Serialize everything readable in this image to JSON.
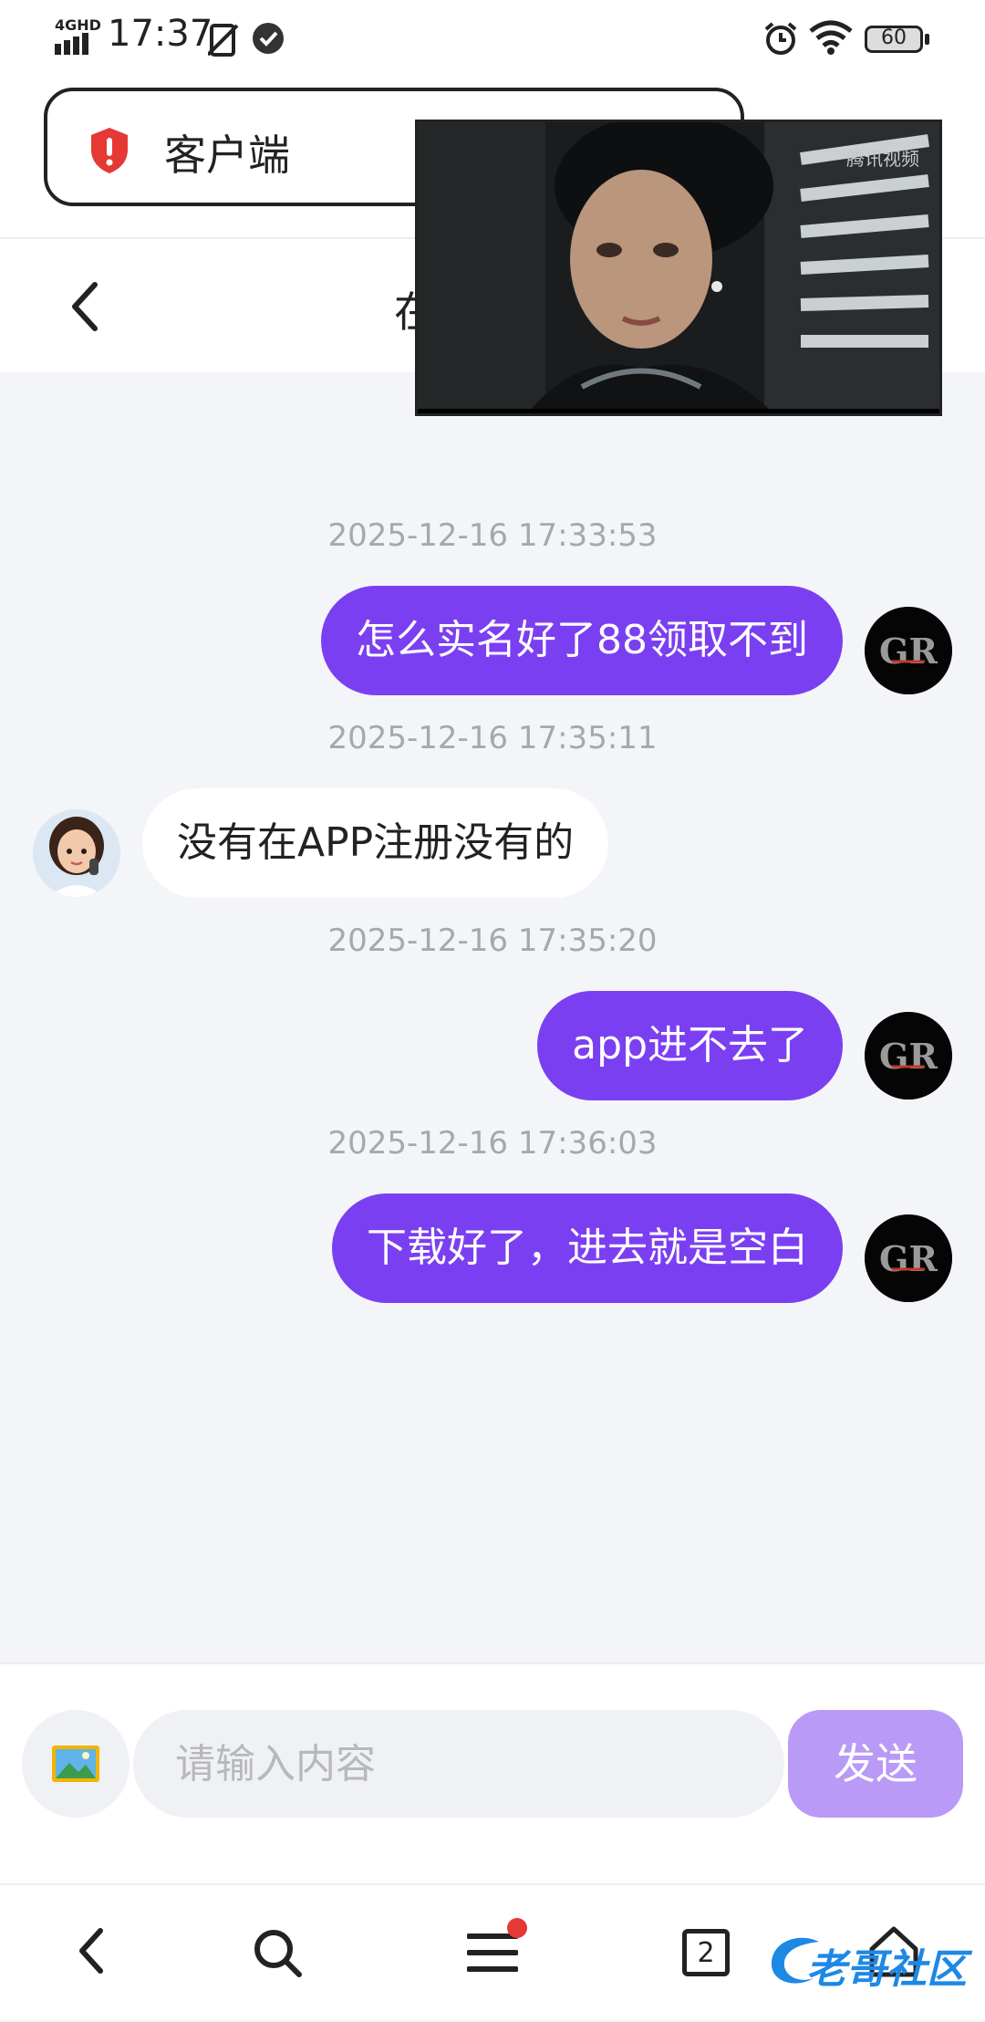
{
  "status_bar": {
    "network": "4GHD",
    "time": "17:37",
    "battery": "60"
  },
  "browser": {
    "tab_title": "客户端",
    "tab_count": "2",
    "video_watermark": "腾讯视频",
    "watermark_text": "老哥社区"
  },
  "chat_header": {
    "title": "在"
  },
  "messages": [
    {
      "timestamp": "2025-12-16 17:33:53",
      "sender": "me",
      "text": "怎么实名好了88领取不到"
    },
    {
      "timestamp": "2025-12-16 17:35:11",
      "sender": "agent",
      "text": "没有在APP注册没有的"
    },
    {
      "timestamp": "2025-12-16 17:35:20",
      "sender": "me",
      "text": "app进不去了"
    },
    {
      "timestamp": "2025-12-16 17:36:03",
      "sender": "me",
      "text": "下载好了，进去就是空白"
    }
  ],
  "composer": {
    "placeholder": "请输入内容",
    "send_label": "发送"
  },
  "colors": {
    "accent": "#7b3ff2",
    "send_disabled": "#b99af6",
    "background": "#f4f5f8"
  }
}
